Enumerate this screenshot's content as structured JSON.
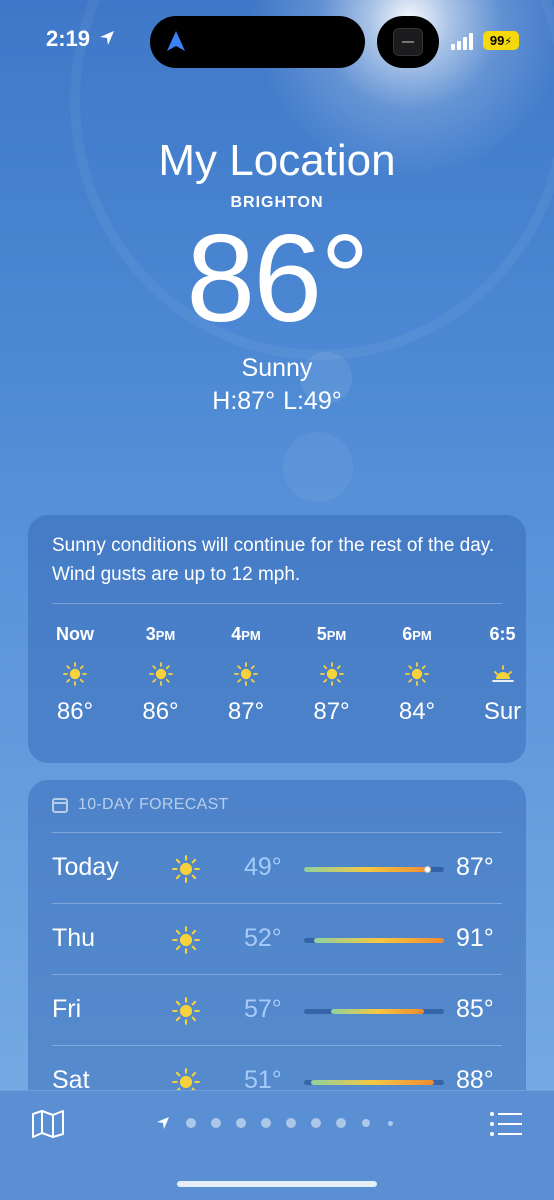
{
  "status_bar": {
    "time": "2:19",
    "battery": "99"
  },
  "hero": {
    "title": "My Location",
    "city": "BRIGHTON",
    "temperature": "86°",
    "condition": "Sunny",
    "high": "H:87°",
    "low": "L:49°"
  },
  "hourly": {
    "summary": "Sunny conditions will continue for the rest of the day. Wind gusts are up to 12 mph.",
    "items": [
      {
        "label": "Now",
        "suffix": "",
        "icon": "sun-icon",
        "temp": "86°"
      },
      {
        "label": "3",
        "suffix": "PM",
        "icon": "sun-icon",
        "temp": "86°"
      },
      {
        "label": "4",
        "suffix": "PM",
        "icon": "sun-icon",
        "temp": "87°"
      },
      {
        "label": "5",
        "suffix": "PM",
        "icon": "sun-icon",
        "temp": "87°"
      },
      {
        "label": "6",
        "suffix": "PM",
        "icon": "sun-icon",
        "temp": "84°"
      },
      {
        "label": "6:5",
        "suffix": "",
        "icon": "sunset-icon",
        "temp": "Sur"
      }
    ]
  },
  "forecast": {
    "title": "10-DAY FORECAST",
    "days": [
      {
        "day": "Today",
        "icon": "sun-icon",
        "low": "49°",
        "high": "87°",
        "current": true
      },
      {
        "day": "Thu",
        "icon": "sun-icon",
        "low": "52°",
        "high": "91°",
        "current": false
      },
      {
        "day": "Fri",
        "icon": "sun-icon",
        "low": "57°",
        "high": "85°",
        "current": false
      },
      {
        "day": "Sat",
        "icon": "sun-icon",
        "low": "51°",
        "high": "88°",
        "current": false
      }
    ]
  },
  "colors": {
    "sun": "#f7d23a",
    "range_gradient": [
      "#8fd19e",
      "#f5c842",
      "#f08a30"
    ]
  }
}
